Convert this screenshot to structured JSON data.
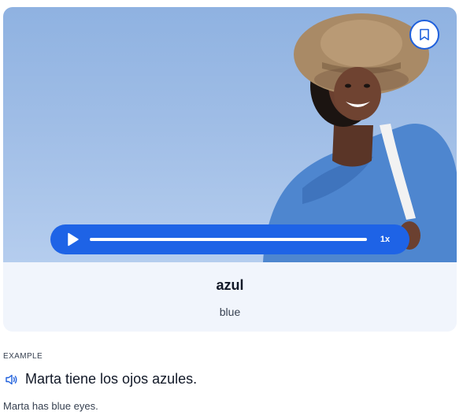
{
  "flashcard": {
    "image_alt": "Woman in a straw hat and blue sweater smiling against a blue sky",
    "word": "azul",
    "translation": "blue",
    "bookmark_icon": "bookmark-icon",
    "player": {
      "play_icon": "play-icon",
      "progress": 1.0,
      "speed_label": "1x"
    }
  },
  "example": {
    "section_label": "EXAMPLE",
    "speaker_icon": "speaker-icon",
    "sentence": "Marta tiene los ojos azules.",
    "translation": "Marta has blue eyes."
  },
  "colors": {
    "accent": "#1e63e6",
    "card_background": "#f1f5fc",
    "sky": "#9fbde6"
  }
}
